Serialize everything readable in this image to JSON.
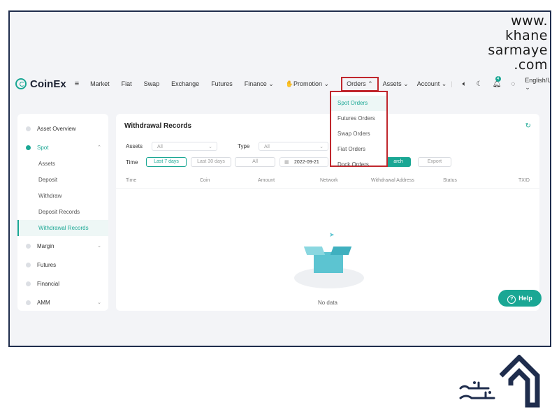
{
  "watermark": {
    "line1": "www.",
    "line2": "khane",
    "line3": "sarmaye",
    "line4": ".com"
  },
  "nav": {
    "logo_text": "CoinEx",
    "menu_icon": "menu-icon",
    "items": [
      "Market",
      "Fiat",
      "Swap",
      "Exchange",
      "Futures"
    ],
    "finance": "Finance",
    "promotion": "Promotion",
    "orders": "Orders",
    "assets": "Assets",
    "account": "Account",
    "notification_count": "4",
    "language": "English/USD"
  },
  "sidebar": {
    "asset_overview": "Asset Overview",
    "spot": "Spot",
    "spot_sub": [
      "Assets",
      "Deposit",
      "Withdraw",
      "Deposit Records",
      "Withdrawal Records"
    ],
    "margin": "Margin",
    "futures": "Futures",
    "financial": "Financial",
    "amm": "AMM"
  },
  "main": {
    "title": "Withdrawal Records",
    "assets_label": "Assets",
    "assets_value": "All",
    "type_label": "Type",
    "type_value": "All",
    "time_label": "Time",
    "last7": "Last 7 days",
    "last30": "Last 30 days",
    "all_btn": "All",
    "date_value": "2022-09-21",
    "search_btn": "arch",
    "export_btn": "Export",
    "columns": [
      "Time",
      "Coin",
      "Amount",
      "Network",
      "Withdrawal Address",
      "Status",
      "TXID"
    ],
    "no_data": "No data"
  },
  "dropdown": {
    "items": [
      "Spot Orders",
      "Futures Orders",
      "Swap Orders",
      "Fiat Orders",
      "Dock Orders"
    ]
  },
  "help": {
    "label": "Help"
  },
  "colors": {
    "accent": "#1aa794",
    "highlight": "#c0272d",
    "frame": "#1f2d4d"
  }
}
